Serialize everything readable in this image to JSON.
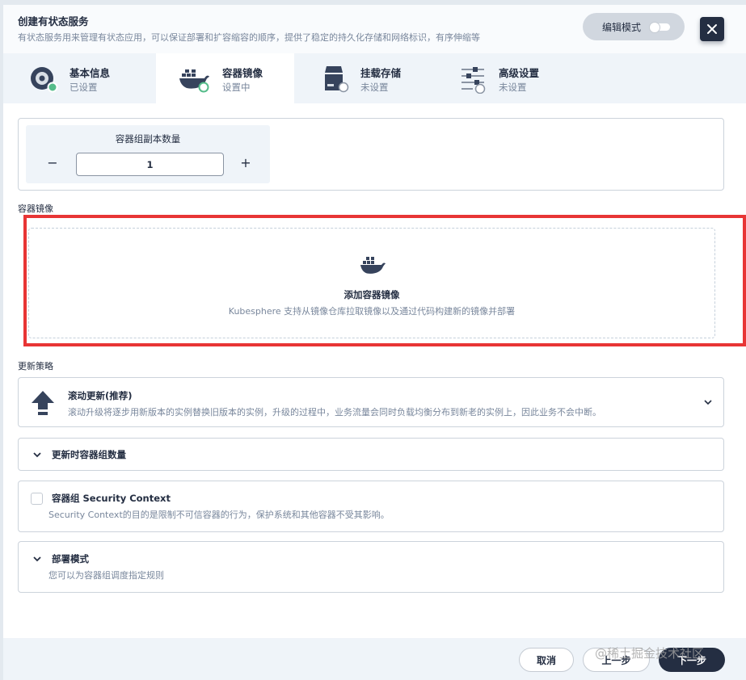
{
  "header": {
    "title": "创建有状态服务",
    "description": "有状态服务用来管理有状态应用，可以保证部署和扩容缩容的顺序，提供了稳定的持久化存储和网络标识，有序伸缩等",
    "edit_mode_label": "编辑模式",
    "close_icon": "close-icon"
  },
  "tabs": [
    {
      "label": "基本信息",
      "status": "已设置",
      "icon": "disc-icon",
      "status_color": "#55bc8a"
    },
    {
      "label": "容器镜像",
      "status": "设置中",
      "icon": "docker-whale-icon",
      "status_color": "#55bc8a"
    },
    {
      "label": "挂载存储",
      "status": "未设置",
      "icon": "storage-drive-icon",
      "status_color": "#ffffff"
    },
    {
      "label": "高级设置",
      "status": "未设置",
      "icon": "sliders-icon",
      "status_color": "#ffffff"
    }
  ],
  "replicas": {
    "title": "容器组副本数量",
    "value": "1",
    "minus_label": "−",
    "plus_label": "+"
  },
  "container_image": {
    "section_label": "容器镜像",
    "add_title": "添加容器镜像",
    "add_description": "Kubesphere 支持从镜像仓库拉取镜像以及通过代码构建新的镜像并部署"
  },
  "update_strategy": {
    "section_label": "更新策略",
    "title": "滚动更新(推荐)",
    "description": "滚动升级将逐步用新版本的实例替换旧版本的实例，升级的过程中，业务流量会同时负载均衡分布到新老的实例上，因此业务不会中断。"
  },
  "pod_count": {
    "title": "更新时容器组数量"
  },
  "security_context": {
    "title": "容器组 Security Context",
    "description": "Security Context的目的是限制不可信容器的行为，保护系统和其他容器不受其影响。"
  },
  "deploy_mode": {
    "title": "部署模式",
    "description": "您可以为容器组调度指定规则"
  },
  "footer": {
    "cancel_label": "取消",
    "prev_label": "上一步",
    "next_label": "下一步"
  },
  "watermark": "@稀土掘金技术社区",
  "colors": {
    "primary_dark": "#242e42",
    "accent_green": "#55bc8a",
    "highlight_red": "#e83535",
    "muted_text": "#79879c",
    "tab_bg": "#eff4f9"
  }
}
